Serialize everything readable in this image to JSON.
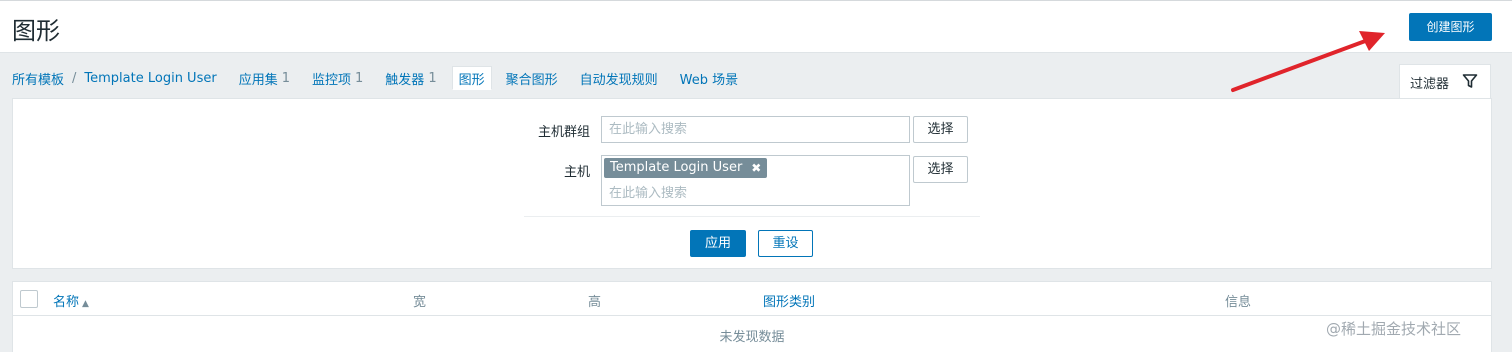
{
  "header": {
    "title": "图形",
    "create_button": "创建图形"
  },
  "nav": {
    "breadcrumb_root": "所有模板",
    "breadcrumb_sep": "/",
    "breadcrumb_current": "Template Login User",
    "tabs": [
      {
        "label": "应用集",
        "count": "1"
      },
      {
        "label": "监控项",
        "count": "1"
      },
      {
        "label": "触发器",
        "count": "1"
      },
      {
        "label": "图形",
        "count": ""
      },
      {
        "label": "聚合图形",
        "count": ""
      },
      {
        "label": "自动发现规则",
        "count": ""
      },
      {
        "label": "Web 场景",
        "count": ""
      }
    ],
    "active_tab": "图形"
  },
  "filter": {
    "tab_label": "过滤器",
    "host_group_label": "主机群组",
    "host_group_placeholder": "在此输入搜索",
    "host_label": "主机",
    "host_tag": "Template Login User",
    "host_placeholder": "在此输入搜索",
    "select_button": "选择",
    "apply_button": "应用",
    "reset_button": "重设"
  },
  "table": {
    "columns": [
      "名称",
      "宽",
      "高",
      "图形类别",
      "信息"
    ],
    "sort_indicator": "▲",
    "empty_text": "未发现数据"
  },
  "watermark": "@稀土掘金技术社区",
  "colors": {
    "accent": "#0275b8",
    "annotation_arrow": "#e0242b"
  }
}
